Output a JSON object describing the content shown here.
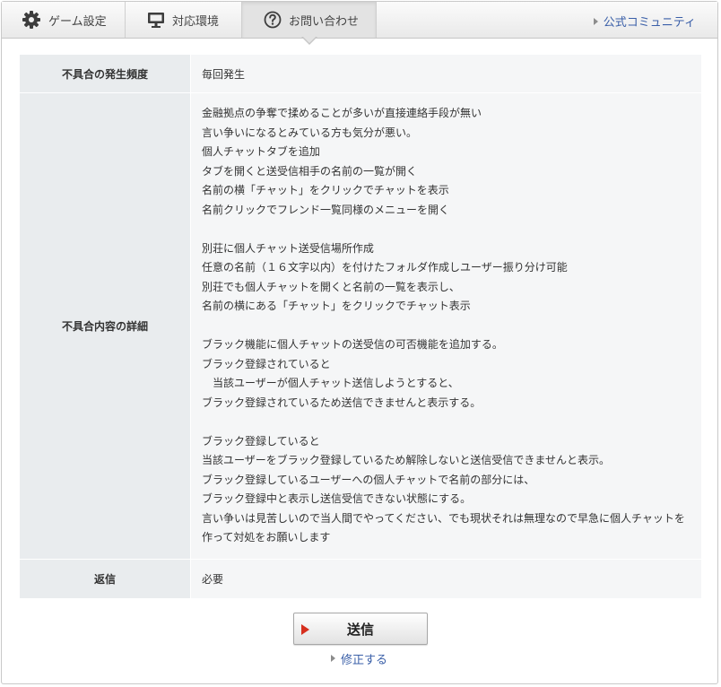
{
  "tabs": {
    "game_settings": {
      "label": "ゲーム設定",
      "icon": "gear-icon"
    },
    "environment": {
      "label": "対応環境",
      "icon": "monitor-icon"
    },
    "contact": {
      "label": "お問い合わせ",
      "icon": "question-circle-icon",
      "active": true
    }
  },
  "header": {
    "community_link": "公式コミュニティ"
  },
  "form": {
    "frequency_label": "不具合の発生頻度",
    "frequency_value": "毎回発生",
    "detail_label": "不具合内容の詳細",
    "detail_lines": [
      "金融拠点の争奪で揉めることが多いが直接連絡手段が無い",
      "言い争いになるとみている方も気分が悪い。",
      "個人チャットタブを追加",
      "タブを開くと送受信相手の名前の一覧が開く",
      "名前の横「チャット」をクリックでチャットを表示",
      "名前クリックでフレンド一覧同様のメニューを開く",
      "",
      "別荘に個人チャット送受信場所作成",
      "任意の名前（１６文字以内）を付けたフォルダ作成しユーザー振り分け可能",
      "別荘でも個人チャットを開くと名前の一覧を表示し、",
      "名前の横にある「チャット」をクリックでチャット表示",
      "",
      "ブラック機能に個人チャットの送受信の可否機能を追加する。",
      "ブラック登録されていると",
      "　当該ユーザーが個人チャット送信しようとすると、",
      "ブラック登録されているため送信できませんと表示する。",
      "",
      "ブラック登録していると",
      "当該ユーザーをブラック登録しているため解除しないと送信受信できませんと表示。",
      "ブラック登録しているユーザーへの個人チャットで名前の部分には、",
      "ブラック登録中と表示し送信受信できない状態にする。",
      "言い争いは見苦しいので当人間でやってください、でも現状それは無理なので早急に個人チャットを",
      "作って対処をお願いします"
    ],
    "reply_label": "返信",
    "reply_value": "必要"
  },
  "actions": {
    "send_label": "送信",
    "fix_label": "修正する"
  },
  "colors": {
    "link": "#3a5fa8",
    "send_arrow": "#d62f1e",
    "label_bg": "#e9ecee",
    "value_bg": "#f5f6f7"
  }
}
